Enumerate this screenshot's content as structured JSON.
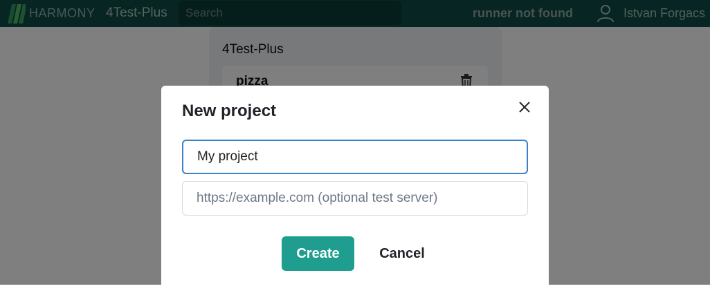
{
  "header": {
    "brand": "HARMONY",
    "project_name": "4Test-Plus",
    "search_placeholder": "Search",
    "runner_status": "runner not found",
    "user_name": "Istvan Forgacs",
    "logo_icon": "harmony-logo-icon",
    "user_icon": "user-icon"
  },
  "background_page": {
    "card_title": "4Test-Plus",
    "items": [
      {
        "name": "pizza",
        "delete_icon": "trash-icon"
      }
    ]
  },
  "modal": {
    "title": "New project",
    "name_value": "My project",
    "url_placeholder": "https://example.com (optional test server)",
    "create_label": "Create",
    "cancel_label": "Cancel",
    "close_icon": "close-icon"
  },
  "colors": {
    "header_bg": "#0e4a44",
    "primary": "#1f9e8f",
    "focus_border": "#3b82c4"
  }
}
